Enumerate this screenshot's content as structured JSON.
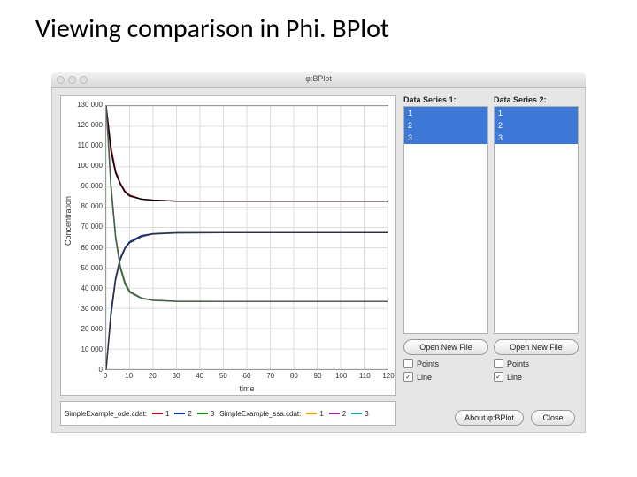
{
  "slide": {
    "title": "Viewing comparison in Phi. BPlot"
  },
  "window": {
    "title": "φ:BPlot"
  },
  "chart_data": {
    "type": "line",
    "xlabel": "time",
    "ylabel": "Concentration",
    "xlim": [
      0,
      120
    ],
    "ylim": [
      0,
      130000
    ],
    "xticks": [
      0,
      10,
      20,
      30,
      40,
      50,
      60,
      70,
      80,
      90,
      100,
      110,
      120
    ],
    "yticks": [
      0,
      10000,
      20000,
      30000,
      40000,
      50000,
      60000,
      70000,
      80000,
      90000,
      100000,
      110000,
      120000,
      130000
    ],
    "series": [
      {
        "name": "ode-1",
        "color": "#c00020",
        "x": [
          0,
          2,
          4,
          6,
          8,
          10,
          15,
          20,
          30,
          50,
          80,
          120
        ],
        "y": [
          130000,
          110000,
          98000,
          92000,
          88000,
          86000,
          84000,
          83500,
          83000,
          83000,
          83000,
          83000
        ]
      },
      {
        "name": "ode-2",
        "color": "#1030c0",
        "x": [
          0,
          2,
          4,
          6,
          8,
          10,
          15,
          20,
          30,
          50,
          80,
          120
        ],
        "y": [
          0,
          28000,
          45000,
          55000,
          60000,
          63000,
          66000,
          67000,
          67500,
          67500,
          67500,
          67500
        ]
      },
      {
        "name": "ode-3",
        "color": "#109010",
        "x": [
          0,
          2,
          4,
          6,
          8,
          10,
          15,
          20,
          30,
          50,
          80,
          120
        ],
        "y": [
          130000,
          90000,
          65000,
          50000,
          42000,
          38000,
          35000,
          34000,
          33500,
          33500,
          33500,
          33500
        ]
      },
      {
        "name": "ssa-1",
        "color": "#000000",
        "x": [
          0,
          2,
          4,
          6,
          8,
          10,
          15,
          20,
          30,
          50,
          80,
          120
        ],
        "y": [
          130000,
          108000,
          97000,
          91500,
          87500,
          85500,
          84000,
          83500,
          83000,
          83000,
          83000,
          83000
        ]
      },
      {
        "name": "ssa-2",
        "color": "#333333",
        "x": [
          0,
          2,
          4,
          6,
          8,
          10,
          15,
          20,
          30,
          50,
          80,
          120
        ],
        "y": [
          0,
          26000,
          44000,
          54000,
          59500,
          62500,
          65500,
          66800,
          67300,
          67500,
          67500,
          67500
        ]
      },
      {
        "name": "ssa-3",
        "color": "#555555",
        "x": [
          0,
          2,
          4,
          6,
          8,
          10,
          15,
          20,
          30,
          50,
          80,
          120
        ],
        "y": [
          130000,
          92000,
          66000,
          51000,
          43000,
          38500,
          35200,
          34100,
          33600,
          33500,
          33500,
          33500
        ]
      }
    ]
  },
  "legend": {
    "files": [
      "SimpleExample_ode.cdat:",
      "SimpleExample_ssa.cdat:"
    ],
    "aItems": [
      "1",
      "2",
      "3"
    ],
    "bItems": [
      "1",
      "2",
      "3"
    ]
  },
  "panels": [
    {
      "header": "Data Series 1:",
      "items": [
        "1",
        "2",
        "3"
      ],
      "openLabel": "Open New File",
      "pointsLabel": "Points",
      "pointsChecked": false,
      "lineLabel": "Line",
      "lineChecked": true
    },
    {
      "header": "Data Series 2:",
      "items": [
        "1",
        "2",
        "3"
      ],
      "openLabel": "Open New File",
      "pointsLabel": "Points",
      "pointsChecked": false,
      "lineLabel": "Line",
      "lineChecked": true
    }
  ],
  "footer": {
    "about": "About φ:BPlot",
    "close": "Close"
  }
}
